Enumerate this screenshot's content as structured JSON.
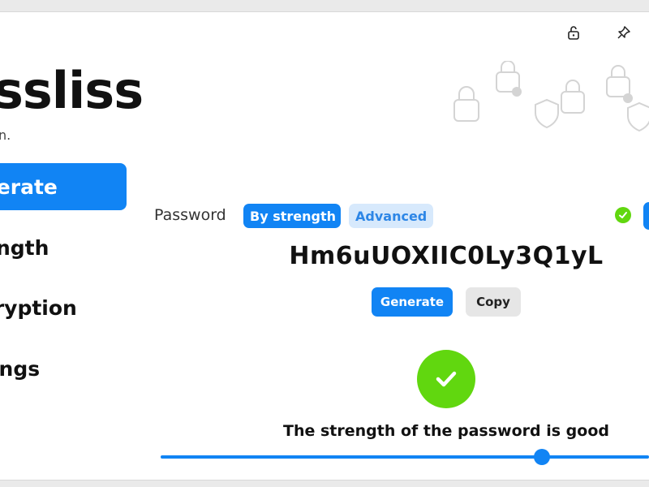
{
  "app": {
    "title": "ssliss",
    "subtitle": "n."
  },
  "titlebar": {
    "lock_icon": "unlock-icon",
    "pin_icon": "pin-icon"
  },
  "nav": {
    "items": [
      {
        "label": "nerate",
        "active": true
      },
      {
        "label": "ength",
        "active": false
      },
      {
        "label": "cryption",
        "active": false
      },
      {
        "label": "tings",
        "active": false
      }
    ]
  },
  "main": {
    "password_label": "Password",
    "modes": {
      "by_strength": "By strength",
      "advanced": "Advanced"
    },
    "password": "Hm6uUOXIIC0Ly3Q1yL",
    "buttons": {
      "generate": "Generate",
      "copy": "Copy"
    },
    "strength_text": "The strength of the password is good",
    "strength_level": 0.78
  },
  "colors": {
    "accent": "#1184f4",
    "success": "#61d70f",
    "accent_light": "#d7e9fc"
  }
}
